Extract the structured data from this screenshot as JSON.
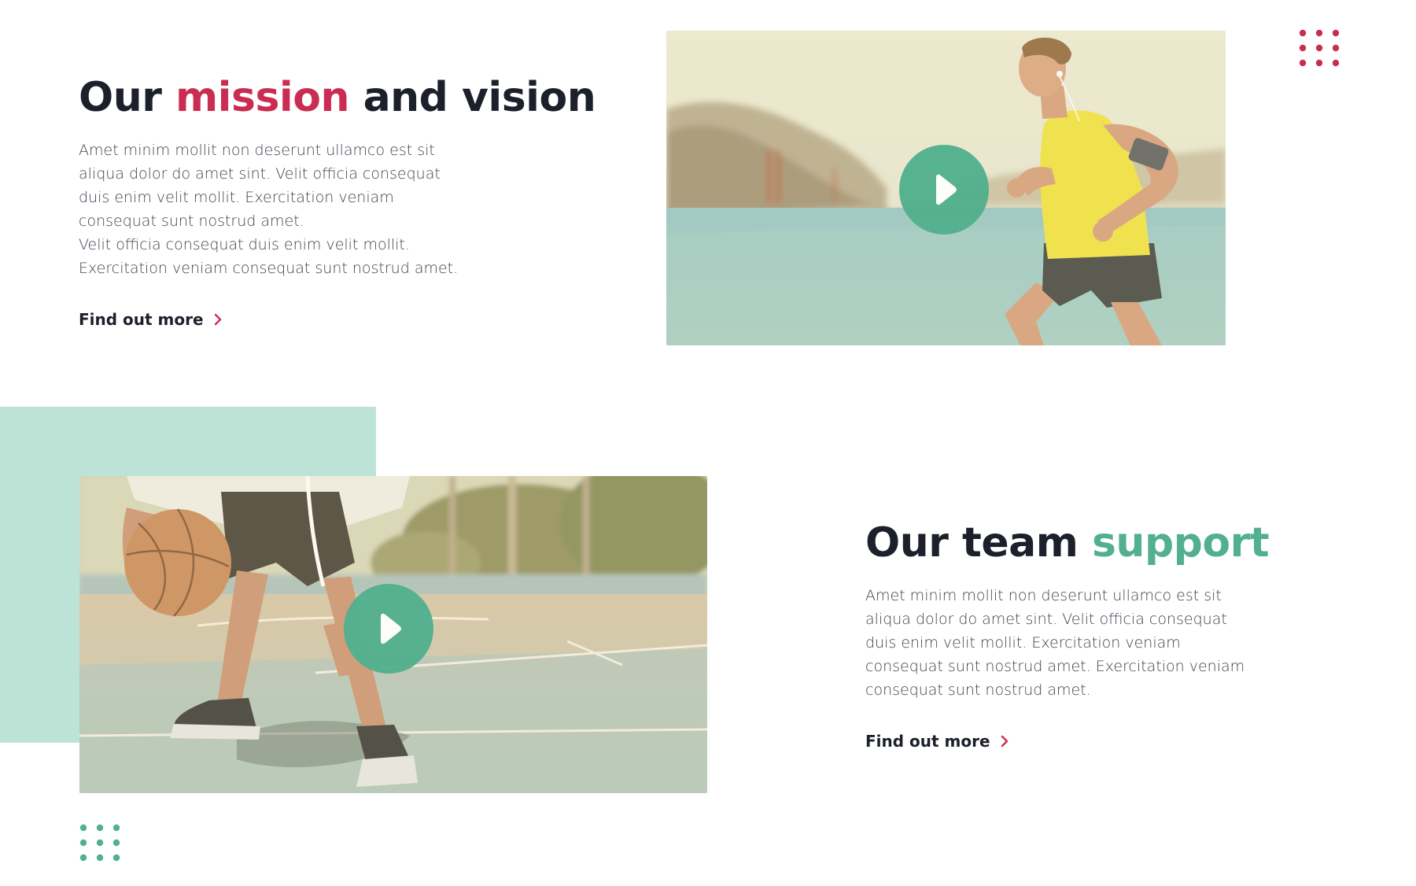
{
  "colors": {
    "accent_red": "#cb2d52",
    "accent_green": "#52b08e",
    "teal_block": "#bde3d6",
    "heading": "#1c202b",
    "body_text": "#3f4350"
  },
  "mission": {
    "heading_part1": "Our ",
    "heading_highlight": "mission",
    "heading_part2": " and vision",
    "paragraph_lines": [
      "Amet minim mollit non deserunt ullamco est sit",
      "aliqua dolor do amet sint. Velit officia consequat",
      "duis enim velit mollit. Exercitation veniam",
      "consequat sunt nostrud amet.",
      "Velit officia consequat duis enim velit mollit.",
      "Exercitation veniam consequat sunt nostrud amet."
    ],
    "link_label": "Find out more",
    "link_icon": "chevron-right-icon",
    "video_icon": "play-icon",
    "image_subject": "runner-photo"
  },
  "team": {
    "heading_part1": "Our team ",
    "heading_highlight": "support",
    "paragraph_lines": [
      "Amet minim mollit non deserunt ullamco est sit",
      "aliqua dolor do amet sint. Velit officia consequat",
      "duis enim velit mollit. Exercitation veniam",
      "consequat sunt nostrud amet. Exercitation veniam",
      "consequat sunt nostrud amet."
    ],
    "link_label": "Find out more",
    "link_icon": "chevron-right-icon",
    "video_icon": "play-icon",
    "image_subject": "basketball-photo"
  },
  "decorations": {
    "top_right_dots_icon": "dot-grid-icon",
    "bottom_left_dots_icon": "dot-grid-icon"
  }
}
